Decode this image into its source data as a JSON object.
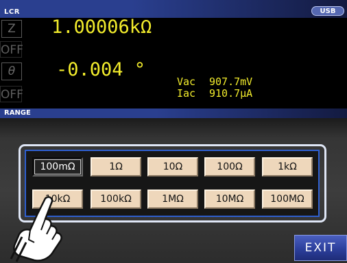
{
  "title_bar": {
    "app_label": "LCR",
    "usb_badge": "USB"
  },
  "measurement": {
    "param1": {
      "symbol": "Z",
      "value": "1.00006kΩ",
      "state": "OFF"
    },
    "param2": {
      "symbol": "θ",
      "value": "-0.004 °",
      "state": "OFF"
    },
    "monitor": {
      "vac_label": "Vac",
      "vac_value": "907.7mV",
      "iac_label": "Iac",
      "iac_value": "910.7μA"
    }
  },
  "range_header": "RANGE",
  "range_buttons": [
    {
      "label": "100mΩ",
      "selected": true
    },
    {
      "label": "1Ω",
      "selected": false
    },
    {
      "label": "10Ω",
      "selected": false
    },
    {
      "label": "100Ω",
      "selected": false
    },
    {
      "label": "1kΩ",
      "selected": false
    },
    {
      "label": "10kΩ",
      "selected": false
    },
    {
      "label": "100kΩ",
      "selected": false
    },
    {
      "label": "1MΩ",
      "selected": false
    },
    {
      "label": "10MΩ",
      "selected": false
    },
    {
      "label": "100MΩ",
      "selected": false
    }
  ],
  "exit_button": "EXIT",
  "colors": {
    "title_bar": "#2a3f8f",
    "value_text": "#f2ec2c",
    "range_button": "#eed7bb",
    "range_button_selected": "#232323",
    "frame_outer": "#dfe6f6",
    "frame_inner": "#2e5fd0",
    "exit_button": "#2c3f9c"
  },
  "icons": {
    "pointer": "pointing-hand-icon"
  }
}
